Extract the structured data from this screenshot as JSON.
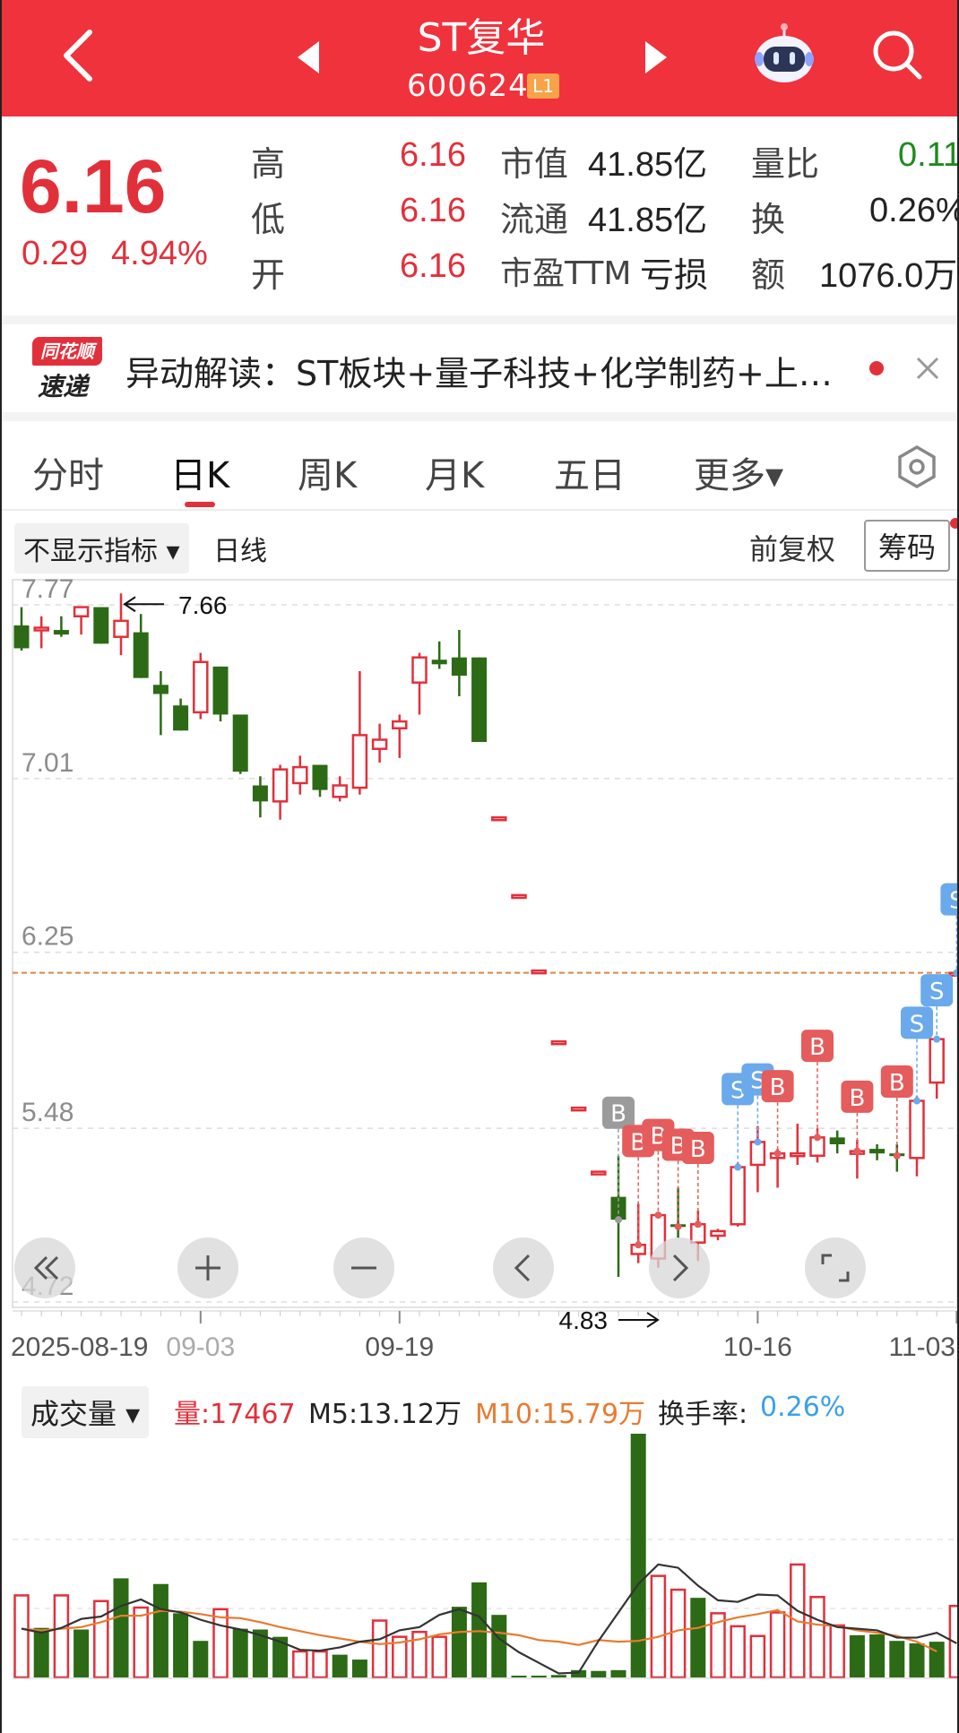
{
  "header": {
    "title": "ST复华",
    "code": "600624",
    "level_badge": "L1",
    "icons": {
      "back": "back-arrow-icon",
      "prev": "prev-stock-icon",
      "next": "next-stock-icon",
      "robot": "robot-assistant-icon",
      "search": "search-icon"
    }
  },
  "quote": {
    "price": "6.16",
    "change": "0.29",
    "change_pct": "4.94%",
    "high_label": "高",
    "high": "6.16",
    "low_label": "低",
    "low": "6.16",
    "open_label": "开",
    "open": "6.16",
    "mktcap_label": "市值",
    "mktcap": "41.85亿",
    "float_label": "流通",
    "float": "41.85亿",
    "pe_label": "市盈TTM",
    "pe": "亏损",
    "volratio_label": "量比",
    "volratio": "0.11",
    "turnover_label": "换",
    "turnover": "0.26%",
    "amount_label": "额",
    "amount": "1076.0万"
  },
  "news": {
    "logo_top": "同花顺",
    "logo_bottom": "速递",
    "text": "异动解读：ST板块+量子科技+化学制药+上…"
  },
  "tabs": [
    {
      "label": "分时"
    },
    {
      "label": "日K"
    },
    {
      "label": "周K"
    },
    {
      "label": "月K"
    },
    {
      "label": "五日"
    },
    {
      "label": "更多▾"
    }
  ],
  "subbar": {
    "indicator_dropdown": "不显示指标 ▾",
    "period": "日线",
    "adjust": "前复权",
    "chips_button": "筹码"
  },
  "chart_data": [
    {
      "type": "candlestick",
      "y_ticks": [
        "7.77",
        "7.01",
        "6.25",
        "5.48",
        "4.72"
      ],
      "ylim": [
        4.72,
        7.77
      ],
      "x_ticks": [
        "2025-08-19",
        "09-03",
        "09-19",
        "10-16",
        "11-03"
      ],
      "max_label": "7.66",
      "min_label": "4.83",
      "reference_price": 6.16,
      "candles": [
        {
          "o": 7.68,
          "h": 7.76,
          "l": 7.57,
          "c": 7.58
        },
        {
          "o": 7.66,
          "h": 7.72,
          "l": 7.58,
          "c": 7.67
        },
        {
          "o": 7.66,
          "h": 7.72,
          "l": 7.63,
          "c": 7.64
        },
        {
          "o": 7.72,
          "h": 7.75,
          "l": 7.64,
          "c": 7.76
        },
        {
          "o": 7.76,
          "h": 7.76,
          "l": 7.6,
          "c": 7.6
        },
        {
          "o": 7.63,
          "h": 7.82,
          "l": 7.55,
          "c": 7.7
        },
        {
          "o": 7.65,
          "h": 7.73,
          "l": 7.45,
          "c": 7.45
        },
        {
          "o": 7.42,
          "h": 7.48,
          "l": 7.2,
          "c": 7.38
        },
        {
          "o": 7.33,
          "h": 7.36,
          "l": 7.22,
          "c": 7.22
        },
        {
          "o": 7.3,
          "h": 7.56,
          "l": 7.27,
          "c": 7.52
        },
        {
          "o": 7.5,
          "h": 7.5,
          "l": 7.26,
          "c": 7.29
        },
        {
          "o": 7.29,
          "h": 7.29,
          "l": 7.03,
          "c": 7.04
        },
        {
          "o": 6.98,
          "h": 7.02,
          "l": 6.84,
          "c": 6.91
        },
        {
          "o": 6.91,
          "h": 7.07,
          "l": 6.83,
          "c": 7.05
        },
        {
          "o": 6.99,
          "h": 7.11,
          "l": 6.94,
          "c": 7.06
        },
        {
          "o": 7.07,
          "h": 7.07,
          "l": 6.93,
          "c": 6.96
        },
        {
          "o": 6.93,
          "h": 7.02,
          "l": 6.91,
          "c": 6.98
        },
        {
          "o": 6.97,
          "h": 7.48,
          "l": 6.94,
          "c": 7.2
        },
        {
          "o": 7.14,
          "h": 7.25,
          "l": 7.08,
          "c": 7.18
        },
        {
          "o": 7.23,
          "h": 7.29,
          "l": 7.1,
          "c": 7.26
        },
        {
          "o": 7.43,
          "h": 7.56,
          "l": 7.29,
          "c": 7.54
        },
        {
          "o": 7.53,
          "h": 7.61,
          "l": 7.49,
          "c": 7.51
        },
        {
          "o": 7.54,
          "h": 7.66,
          "l": 7.37,
          "c": 7.46
        },
        {
          "o": 7.54,
          "h": 7.54,
          "l": 7.17,
          "c": 7.17
        },
        {
          "o": 6.84,
          "h": 6.84,
          "l": 6.84,
          "c": 6.84
        },
        {
          "o": 6.5,
          "h": 6.5,
          "l": 6.5,
          "c": 6.5
        },
        {
          "o": 6.17,
          "h": 6.17,
          "l": 6.17,
          "c": 6.17
        },
        {
          "o": 5.86,
          "h": 5.86,
          "l": 5.86,
          "c": 5.86
        },
        {
          "o": 5.57,
          "h": 5.57,
          "l": 5.57,
          "c": 5.57
        },
        {
          "o": 5.29,
          "h": 5.29,
          "l": 5.29,
          "c": 5.29
        },
        {
          "o": 5.18,
          "h": 5.36,
          "l": 4.83,
          "c": 5.08
        },
        {
          "o": 4.93,
          "h": 5.15,
          "l": 4.89,
          "c": 4.97
        },
        {
          "o": 4.91,
          "h": 5.09,
          "l": 4.87,
          "c": 5.1
        },
        {
          "o": 5.06,
          "h": 5.22,
          "l": 5.0,
          "c": 5.05
        },
        {
          "o": 4.98,
          "h": 5.12,
          "l": 4.9,
          "c": 5.06
        },
        {
          "o": 5.01,
          "h": 5.04,
          "l": 4.99,
          "c": 5.03
        },
        {
          "o": 5.06,
          "h": 5.33,
          "l": 5.05,
          "c": 5.31
        },
        {
          "o": 5.32,
          "h": 5.49,
          "l": 5.2,
          "c": 5.42
        },
        {
          "o": 5.35,
          "h": 5.39,
          "l": 5.22,
          "c": 5.37
        },
        {
          "o": 5.36,
          "h": 5.5,
          "l": 5.32,
          "c": 5.37
        },
        {
          "o": 5.36,
          "h": 5.48,
          "l": 5.33,
          "c": 5.44
        },
        {
          "o": 5.44,
          "h": 5.47,
          "l": 5.37,
          "c": 5.41
        },
        {
          "o": 5.38,
          "h": 5.43,
          "l": 5.26,
          "c": 5.38
        },
        {
          "o": 5.39,
          "h": 5.41,
          "l": 5.34,
          "c": 5.37
        },
        {
          "o": 5.37,
          "h": 5.41,
          "l": 5.29,
          "c": 5.36
        },
        {
          "o": 5.35,
          "h": 5.62,
          "l": 5.27,
          "c": 5.6
        },
        {
          "o": 5.68,
          "h": 5.88,
          "l": 5.61,
          "c": 5.87
        },
        {
          "o": 6.16,
          "h": 6.16,
          "l": 6.16,
          "c": 6.16
        }
      ],
      "trade_marks": [
        {
          "i": 30,
          "type": "B",
          "color": "#9b9b9b"
        },
        {
          "i": 31,
          "type": "B",
          "color": "#e55c5c"
        },
        {
          "i": 32,
          "type": "B",
          "color": "#e55c5c"
        },
        {
          "i": 33,
          "type": "B",
          "color": "#e55c5c"
        },
        {
          "i": 34,
          "type": "B",
          "color": "#e55c5c"
        },
        {
          "i": 36,
          "type": "S",
          "color": "#6aa9ec"
        },
        {
          "i": 37,
          "type": "S",
          "color": "#6aa9ec"
        },
        {
          "i": 38,
          "type": "B",
          "color": "#e55c5c"
        },
        {
          "i": 40,
          "type": "B",
          "color": "#e55c5c"
        },
        {
          "i": 42,
          "type": "B",
          "color": "#e55c5c"
        },
        {
          "i": 44,
          "type": "B",
          "color": "#e55c5c"
        },
        {
          "i": 45,
          "type": "S",
          "color": "#6aa9ec"
        },
        {
          "i": 46,
          "type": "S",
          "color": "#6aa9ec"
        },
        {
          "i": 47,
          "type": "S",
          "color": "#6aa9ec"
        }
      ],
      "colors": {
        "up": "#e2303b",
        "down": "#2c6a15",
        "grid": "#dddddd",
        "ref_line": "#d8884a"
      }
    },
    {
      "type": "bar",
      "header": {
        "dropdown": "成交量 ▾",
        "vol": "量:17467",
        "m5": "M5:13.12万",
        "m10": "M10:15.79万",
        "turnover_label": "换手率:",
        "turnover_value": "0.26%"
      },
      "values": [
        10.1,
        6.1,
        10.1,
        5.9,
        9.4,
        12.2,
        8.6,
        11.5,
        7.9,
        4.5,
        8.4,
        6.0,
        5.9,
        5.0,
        3.2,
        3.2,
        2.8,
        2.2,
        7.0,
        5.0,
        5.6,
        5.0,
        8.7,
        11.7,
        7.7,
        0.15,
        0.15,
        0.3,
        0.9,
        0.8,
        0.9,
        30.0,
        12.5,
        10.8,
        9.8,
        7.9,
        6.3,
        5.1,
        8.0,
        13.9,
        9.9,
        6.4,
        5.2,
        5.3,
        4.5,
        4.2,
        4.4,
        8.8,
        3.3
      ],
      "up": [
        true,
        false,
        true,
        false,
        true,
        false,
        true,
        false,
        false,
        false,
        true,
        false,
        false,
        false,
        true,
        true,
        false,
        false,
        true,
        true,
        true,
        true,
        false,
        false,
        false,
        false,
        false,
        false,
        false,
        false,
        false,
        false,
        true,
        true,
        false,
        true,
        true,
        true,
        true,
        true,
        true,
        true,
        false,
        false,
        false,
        false,
        false,
        true,
        true
      ],
      "m5": [
        6.0,
        5.5,
        6.1,
        7.2,
        7.5,
        8.8,
        9.6,
        8.4,
        8.0,
        7.1,
        6.4,
        5.9,
        5.2,
        4.4,
        3.4,
        3.3,
        3.7,
        4.4,
        4.7,
        5.8,
        6.2,
        7.7,
        8.4,
        7.5,
        4.8,
        3.1,
        1.8,
        0.5,
        0.6,
        4.5,
        8.0,
        11.5,
        13.9,
        13.5,
        11.3,
        9.5,
        9.3,
        10.2,
        10.1,
        8.2,
        7.1,
        6.2,
        6.0,
        5.8,
        4.9,
        4.9,
        5.5,
        4.2
      ],
      "m10": [
        6.0,
        5.8,
        6.0,
        6.2,
        6.8,
        7.6,
        7.6,
        8.2,
        8.1,
        7.8,
        7.4,
        7.3,
        6.8,
        6.2,
        5.7,
        5.2,
        4.8,
        4.4,
        4.1,
        4.3,
        4.7,
        5.3,
        5.6,
        5.7,
        5.5,
        5.2,
        4.6,
        4.4,
        4.0,
        4.6,
        4.4,
        4.5,
        5.0,
        5.8,
        6.1,
        6.8,
        7.4,
        7.8,
        8.3,
        6.9,
        6.5,
        6.3,
        5.8,
        5.5,
        5.1,
        4.4,
        3.2
      ],
      "colors": {
        "up": "#e2303b",
        "down": "#2c6a15",
        "m5": "#333333",
        "m10": "#e87b30"
      }
    }
  ]
}
